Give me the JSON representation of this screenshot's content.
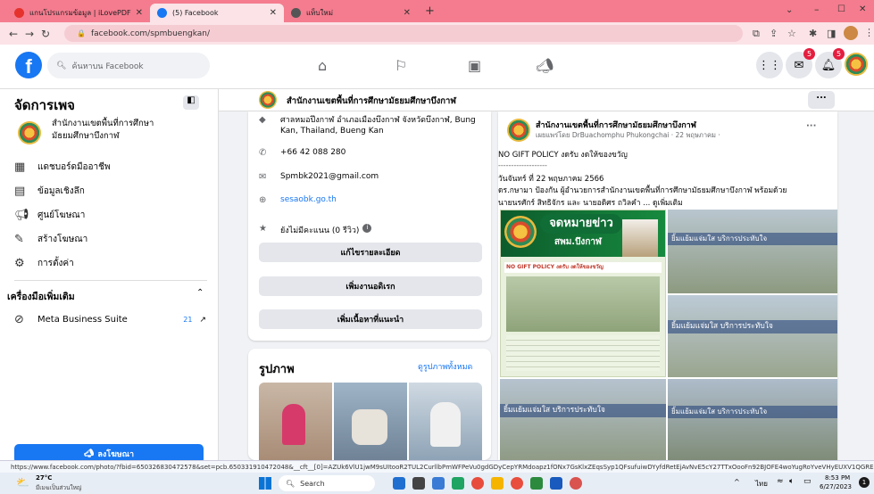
{
  "browser": {
    "tabs": [
      {
        "title": "แกนโปรแกรมข้อมูล | iLovePDF",
        "active": false
      },
      {
        "title": "(5) Facebook",
        "active": true
      },
      {
        "title": "แท็บใหม่",
        "active": false
      }
    ],
    "new_tab": "+",
    "url": "facebook.com/spmbuengkan/",
    "status_url": "https://www.facebook.com/photo/?fbid=650326830472578&set=pcb.650331910472048&__cft__[0]=AZUk6VlU1jwM9sUItooR2TUL2CurllbPmWFPeVu0gdGDyCepYRMdoapz1fONx7GsKlxZEqsSyp1QFsufuiwDYyfdRetEjAvNvE5cY27TTxOooFn92BJOFE4woYugRoYveVHyEUXV1QGRErG..."
  },
  "topbar": {
    "search_placeholder": "ค้นหาบน Facebook",
    "badge_messenger": "5",
    "badge_notif": "5"
  },
  "sidebar": {
    "header": "จัดการเพจ",
    "page_name": "สำนักงานเขตพื้นที่การศึกษามัธยมศึกษาบึงกาฬ",
    "items": [
      {
        "label": "แดชบอร์ดมืออาชีพ",
        "icon": "dashboard-icon"
      },
      {
        "label": "ข้อมูลเชิงลึก",
        "icon": "insights-icon"
      },
      {
        "label": "ศูนย์โฆษณา",
        "icon": "megaphone-icon"
      },
      {
        "label": "สร้างโฆษณา",
        "icon": "edit-icon"
      },
      {
        "label": "การตั้งค่า",
        "icon": "gear-icon"
      }
    ],
    "more_tools": "เครื่องมือเพิ่มเติม",
    "mbs_label": "Meta Business Suite",
    "mbs_count": "21",
    "promote_btn": "ลงโฆษณา"
  },
  "page_header": {
    "title": "สำนักงานเขตพื้นที่การศึกษามัธยมศึกษาบึงกาฬ",
    "more": "..."
  },
  "intro": {
    "address": "ศาลหมอปึงกาฬ อำเภอเมืองบึงกาฬ จังหวัดบึงกาฬ, Bung Kan, Thailand, Bueng Kan",
    "phone": "+66 42 088 280",
    "email": "Spmbk2021@gmail.com",
    "website": "sesaobk.go.th",
    "rating": "ยังไม่มีคะแนน (0 รีวิว)",
    "btn_edit": "แก้ไขรายละเอียด",
    "btn_featured": "เพิ่มงานอดิเรก",
    "btn_content": "เพิ่มเนื้อหาที่แนะนำ"
  },
  "photos": {
    "title": "รูปภาพ",
    "see_all": "ดูรูปภาพทั้งหมด"
  },
  "post": {
    "author": "สำนักงานเขตพื้นที่การศึกษามัธยมศึกษาบึงกาฬ",
    "meta": "เผยแพร่โดย DrBuachomphu Phukongchai · 22 พฤษภาคม ·",
    "line1": "NO GIFT POLICY งดรับ งดให้ของขวัญ",
    "line2": "-------------------",
    "line3": "วันจันทร์ ที่ 22 พฤษภาคม 2566",
    "line4": "ดร.กษามา ป้องกัน ผู้อำนวยการสำนักงานเขตพื้นที่การศึกษามัธยมศึกษาบึงกาฬ พร้อมด้วย",
    "line5": "นายนรศักร์ สิทธิจักร และ นายอดิศร ถวิลคำ ... ดูเพิ่มเติม",
    "banner1": "จดหมายข่าว",
    "banner2": "สพม.บึงกาฬ",
    "nogift": "NO GIFT POLICY งดรับ งดให้ของขวัญ",
    "caption1": "ยิ้มแย้มแจ่มใส บริการประทับใจ",
    "caption2": "ยิ้มแย้มแจ่มใส บริการประทับใจ",
    "caption3": "ยิ้มแย้มแจ่มใส บริการประทับใจ",
    "caption4": "ยิ้มแย้มแจ่มใส บริการประทับใจ"
  },
  "taskbar": {
    "weather_temp": "27°C",
    "weather_desc": "มีเมฆเป็นส่วนใหญ่",
    "search": "Search",
    "lang": "ไทย",
    "time": "8:53 PM",
    "date": "6/27/2023"
  }
}
